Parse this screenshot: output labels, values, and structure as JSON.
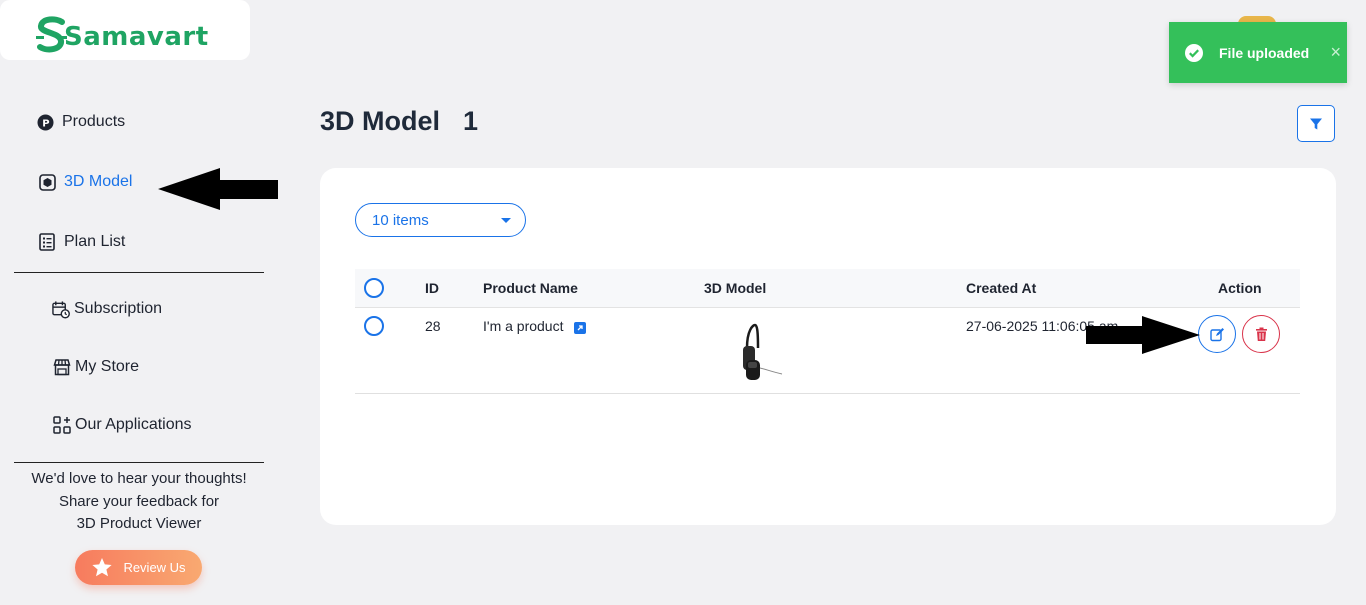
{
  "brand": {
    "name": "Samavart"
  },
  "sidebar": {
    "items": [
      {
        "label": "Products",
        "icon": "products-p-icon"
      },
      {
        "label": "3D Model",
        "icon": "cube-icon",
        "active": true
      },
      {
        "label": "Plan List",
        "icon": "list-icon"
      },
      {
        "label": "Subscription",
        "icon": "calendar-clock-icon"
      },
      {
        "label": "My Store",
        "icon": "store-icon"
      },
      {
        "label": "Our Applications",
        "icon": "apps-grid-icon"
      }
    ],
    "feedback": {
      "line1": "We'd love to hear your thoughts!",
      "line2": "Share your feedback for",
      "line3": "3D Product Viewer",
      "button": "Review Us"
    }
  },
  "header": {
    "title": "3D Model",
    "count": "1"
  },
  "toolbar": {
    "page_size": "10 items"
  },
  "table": {
    "columns": [
      "ID",
      "Product Name",
      "3D Model",
      "Created At",
      "Action"
    ],
    "rows": [
      {
        "id": "28",
        "product_name": "I'm a product",
        "created_at": "27-06-2025 11:06:05 am"
      }
    ]
  },
  "toast": {
    "message": "File uploaded",
    "close": "×"
  },
  "colors": {
    "accent": "#1a73e8",
    "brand": "#1fa463",
    "success": "#34c05a",
    "danger": "#d9334a"
  }
}
